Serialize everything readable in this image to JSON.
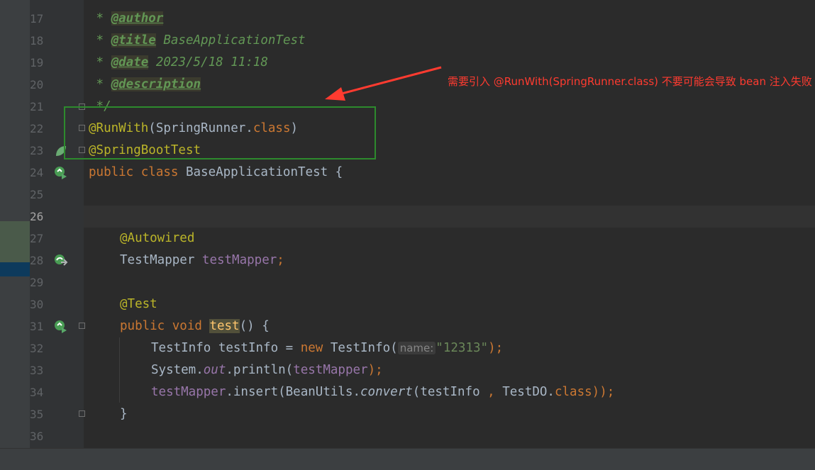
{
  "lines": [
    {
      "n": "17",
      "parts": [
        {
          "t": " * ",
          "c": "doc"
        },
        {
          "t": "@author",
          "c": "tag"
        }
      ]
    },
    {
      "n": "18",
      "parts": [
        {
          "t": " * ",
          "c": "doc"
        },
        {
          "t": "@title",
          "c": "tag"
        },
        {
          "t": " BaseApplicationTest",
          "c": "doc"
        }
      ]
    },
    {
      "n": "19",
      "parts": [
        {
          "t": " * ",
          "c": "doc"
        },
        {
          "t": "@date",
          "c": "tag"
        },
        {
          "t": " 2023/5/18 11:18",
          "c": "doc"
        }
      ]
    },
    {
      "n": "20",
      "parts": [
        {
          "t": " * ",
          "c": "doc"
        },
        {
          "t": "@description",
          "c": "tag"
        }
      ]
    },
    {
      "n": "21",
      "parts": [
        {
          "t": " */",
          "c": "doc"
        }
      ]
    },
    {
      "n": "22",
      "parts": [
        {
          "t": "@RunWith",
          "c": "ann"
        },
        {
          "t": "(SpringRunner.",
          "c": ""
        },
        {
          "t": "class",
          "c": "kw"
        },
        {
          "t": ")",
          "c": ""
        }
      ]
    },
    {
      "n": "23",
      "parts": [
        {
          "t": "@SpringBootTest",
          "c": "ann"
        }
      ]
    },
    {
      "n": "24",
      "parts": [
        {
          "t": "public class ",
          "c": "kw"
        },
        {
          "t": "BaseApplicationTest {",
          "c": ""
        }
      ]
    },
    {
      "n": "25",
      "parts": []
    },
    {
      "n": "26",
      "parts": []
    },
    {
      "n": "27",
      "parts": [
        {
          "t": "@Autowired",
          "c": "ann"
        }
      ]
    },
    {
      "n": "28",
      "parts": [
        {
          "t": "TestMapper ",
          "c": ""
        },
        {
          "t": "testMapper",
          "c": "fld"
        },
        {
          "t": ";",
          "c": "kw"
        }
      ]
    },
    {
      "n": "29",
      "parts": []
    },
    {
      "n": "30",
      "parts": [
        {
          "t": "@Test",
          "c": "ann"
        }
      ]
    },
    {
      "n": "31",
      "parts": [
        {
          "t": "public void ",
          "c": "kw"
        },
        {
          "t": "test",
          "c": "mth-hl"
        },
        {
          "t": "() {",
          "c": ""
        }
      ]
    },
    {
      "n": "32",
      "parts": [
        {
          "t": "TestInfo testInfo = ",
          "c": ""
        },
        {
          "t": "new ",
          "c": "kw"
        },
        {
          "t": "TestInfo(",
          "c": ""
        },
        {
          "t": "name:",
          "c": "hint"
        },
        {
          "t": "\"12313\"",
          "c": "str"
        },
        {
          "t": ");",
          "c": "kw"
        }
      ]
    },
    {
      "n": "33",
      "parts": [
        {
          "t": "System.",
          "c": ""
        },
        {
          "t": "out",
          "c": "fld-i"
        },
        {
          "t": ".println(",
          "c": ""
        },
        {
          "t": "testMapper",
          "c": "fld"
        },
        {
          "t": ");",
          "c": "kw"
        }
      ]
    },
    {
      "n": "34",
      "parts": [
        {
          "t": "testMapper",
          "c": "fld"
        },
        {
          "t": ".insert(BeanUtils.",
          "c": ""
        },
        {
          "t": "convert",
          "c": "it"
        },
        {
          "t": "(testInfo ",
          "c": ""
        },
        {
          "t": ", ",
          "c": "kw"
        },
        {
          "t": "TestDO.",
          "c": ""
        },
        {
          "t": "class",
          "c": "kw"
        },
        {
          "t": "));",
          "c": "kw"
        }
      ]
    },
    {
      "n": "35",
      "parts": [
        {
          "t": "}",
          "c": ""
        }
      ]
    },
    {
      "n": "36",
      "parts": []
    }
  ],
  "annotation": {
    "note": "需要引入 @RunWith(SpringRunner.class) 不要可能会导致 bean 注入失败",
    "box_color": "#2d8a2d",
    "arrow_color": "#ff3b30"
  }
}
